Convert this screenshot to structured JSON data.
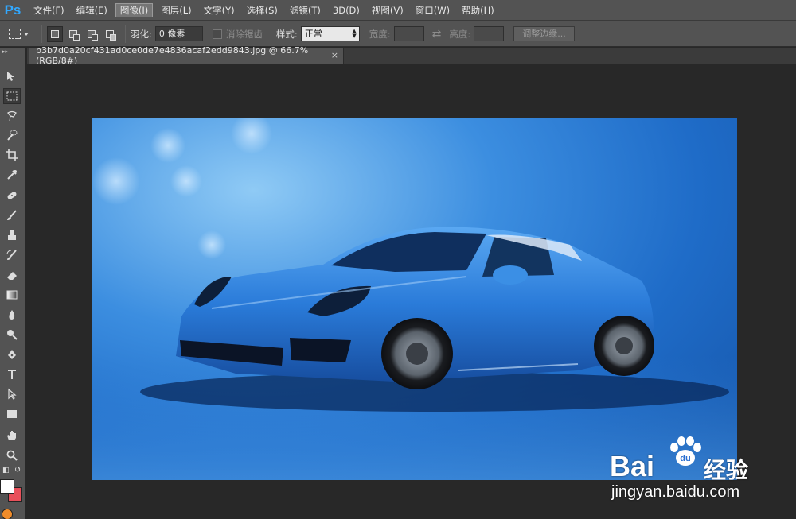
{
  "app": {
    "logo": "Ps"
  },
  "menu": [
    {
      "label": "文件(F)",
      "active": false
    },
    {
      "label": "编辑(E)",
      "active": false
    },
    {
      "label": "图像(I)",
      "active": true
    },
    {
      "label": "图层(L)",
      "active": false
    },
    {
      "label": "文字(Y)",
      "active": false
    },
    {
      "label": "选择(S)",
      "active": false
    },
    {
      "label": "滤镜(T)",
      "active": false
    },
    {
      "label": "3D(D)",
      "active": false
    },
    {
      "label": "视图(V)",
      "active": false
    },
    {
      "label": "窗口(W)",
      "active": false
    },
    {
      "label": "帮助(H)",
      "active": false
    }
  ],
  "options": {
    "feather_label": "羽化:",
    "feather_value": "0 像素",
    "antialias_label": "消除锯齿",
    "style_label": "样式:",
    "style_value": "正常",
    "width_label": "宽度:",
    "height_label": "高度:",
    "refine_edge_label": "调整边缘..."
  },
  "document": {
    "tab_title": "b3b7d0a20cf431ad0ce0de7e4836acaf2edd9843.jpg @ 66.7%(RGB/8#)",
    "close_glyph": "×"
  },
  "colors": {
    "foreground": "#ffffff",
    "background": "#e8505a",
    "accent": "#31a8ff"
  },
  "watermark": {
    "brand": "Bai",
    "brand2": "du",
    "jingyan": "经验",
    "url": "jingyan.baidu.com"
  }
}
